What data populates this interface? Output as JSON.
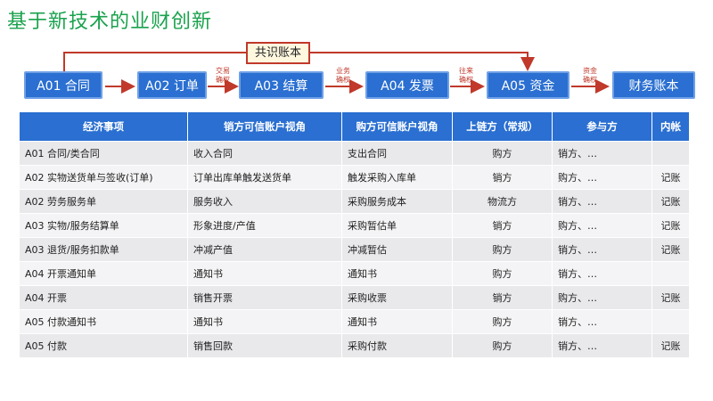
{
  "title": "基于新技术的业财创新",
  "diagram": {
    "shared_ledger": "共识账本",
    "boxes": [
      "A01 合同",
      "A02 订单",
      "A03 结算",
      "A04 发票",
      "A05 资金",
      "财务账本"
    ],
    "arrow_labels": [
      "交易\n确权",
      "业务\n确权",
      "往来\n确权",
      "资金\n确权"
    ],
    "colors": {
      "box": "#2a6fd1",
      "arrow": "#c0392b",
      "title": "#1aa24d"
    }
  },
  "table": {
    "headers": [
      "经济事项",
      "销方可信账户视角",
      "购方可信账户视角",
      "上链方（常规）",
      "参与方",
      "内帐"
    ],
    "rows": [
      [
        "A01 合同/类合同",
        "收入合同",
        "支出合同",
        "购方",
        "销方、…",
        ""
      ],
      [
        "A02 实物送货单与签收(订单)",
        "订单出库单触发送货单",
        "触发采购入库单",
        "销方",
        "购方、…",
        "记账"
      ],
      [
        "A02 劳务服务单",
        "服务收入",
        "采购服务成本",
        "物流方",
        "销方、…",
        "记账"
      ],
      [
        "A03 实物/服务结算单",
        "形象进度/产值",
        "采购暂估单",
        "销方",
        "购方、…",
        "记账"
      ],
      [
        "A03 退货/服务扣款单",
        "冲减产值",
        "冲减暂估",
        "购方",
        "销方、…",
        "记账"
      ],
      [
        "A04 开票通知单",
        "通知书",
        "通知书",
        "购方",
        "销方、…",
        ""
      ],
      [
        "A04 开票",
        "销售开票",
        "采购收票",
        "销方",
        "购方、…",
        "记账"
      ],
      [
        "A05 付款通知书",
        "通知书",
        "通知书",
        "购方",
        "销方、…",
        ""
      ],
      [
        "A05 付款",
        "销售回款",
        "采购付款",
        "购方",
        "销方、…",
        "记账"
      ]
    ]
  }
}
